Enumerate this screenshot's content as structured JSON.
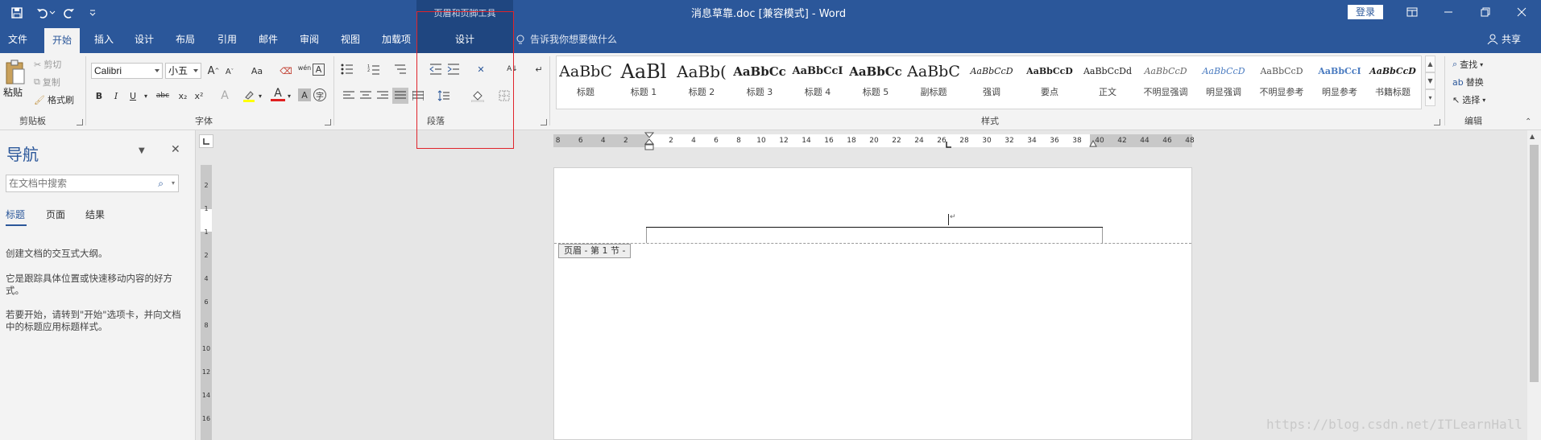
{
  "window": {
    "title": "消息草靠.doc [兼容模式]  -  Word",
    "context_title": "页眉和页脚工具",
    "login": "登录",
    "accent_color": "#2b579a"
  },
  "quick_access": [
    "save-icon",
    "undo-icon",
    "redo-icon",
    "customize-icon"
  ],
  "tabs": [
    "文件",
    "开始",
    "插入",
    "设计",
    "布局",
    "引用",
    "邮件",
    "审阅",
    "视图",
    "加载项",
    "设计"
  ],
  "active_tab": "开始",
  "tell_me": "告诉我你想要做什么",
  "share": "共享",
  "ribbon": {
    "clipboard": {
      "paste": "粘贴",
      "cut": "剪切",
      "copy": "复制",
      "format_painter": "格式刷",
      "label": "剪贴板"
    },
    "font": {
      "name": "Calibri",
      "size": "小五",
      "label": "字体",
      "bold": "B",
      "italic": "I",
      "underline": "U",
      "strike": "abc",
      "sub": "x₂",
      "sup": "x²",
      "grow": "A",
      "shrink": "A",
      "case": "Aa",
      "pinyin": "wén",
      "charborder": "A"
    },
    "paragraph": {
      "label": "段落"
    },
    "styles": {
      "label": "样式",
      "items": [
        {
          "sample": "AaBbC",
          "name": "标题"
        },
        {
          "sample": "AaBl",
          "name": "标题 1"
        },
        {
          "sample": "AaBb(",
          "name": "标题 2"
        },
        {
          "sample": "AaBbCc",
          "name": "标题 3"
        },
        {
          "sample": "AaBbCcI",
          "name": "标题 4"
        },
        {
          "sample": "AaBbCc",
          "name": "标题 5"
        },
        {
          "sample": "AaBbC",
          "name": "副标题"
        },
        {
          "sample": "AaBbCcD",
          "name": "强调"
        },
        {
          "sample": "AaBbCcD",
          "name": "要点"
        },
        {
          "sample": "AaBbCcDd",
          "name": "正文"
        },
        {
          "sample": "AaBbCcD",
          "name": "不明显强调"
        },
        {
          "sample": "AaBbCcD",
          "name": "明显强调"
        },
        {
          "sample": "AaBbCcD",
          "name": "不明显参考"
        },
        {
          "sample": "AaBbCcI",
          "name": "明显参考"
        },
        {
          "sample": "AaBbCcD",
          "name": "书籍标题"
        }
      ]
    },
    "editing": {
      "find": "查找",
      "replace": "替换",
      "select": "选择",
      "label": "编辑"
    }
  },
  "nav": {
    "title": "导航",
    "search_placeholder": "在文档中搜索",
    "tabs": [
      "标题",
      "页面",
      "结果"
    ],
    "active_tab": "标题",
    "text1": "创建文档的交互式大纲。",
    "text2": "它是跟踪具体位置或快速移动内容的好方式。",
    "text3": "若要开始，请转到\"开始\"选项卡，并向文档中的标题应用标题样式。"
  },
  "ruler": {
    "h_left": [
      "8",
      "6",
      "4",
      "2"
    ],
    "h_right": [
      "2",
      "4",
      "6",
      "8",
      "10",
      "12",
      "14",
      "16",
      "18",
      "20",
      "22",
      "24",
      "26",
      "28",
      "30",
      "32",
      "34",
      "36",
      "38",
      "40",
      "42",
      "44",
      "46",
      "48"
    ],
    "v": [
      "2",
      "1",
      "1",
      "2",
      "4",
      "6",
      "8",
      "10",
      "12",
      "14",
      "16"
    ]
  },
  "page": {
    "header_tag": "页眉 - 第 1 节 -"
  },
  "watermark": "https://blog.csdn.net/ITLearnHall"
}
